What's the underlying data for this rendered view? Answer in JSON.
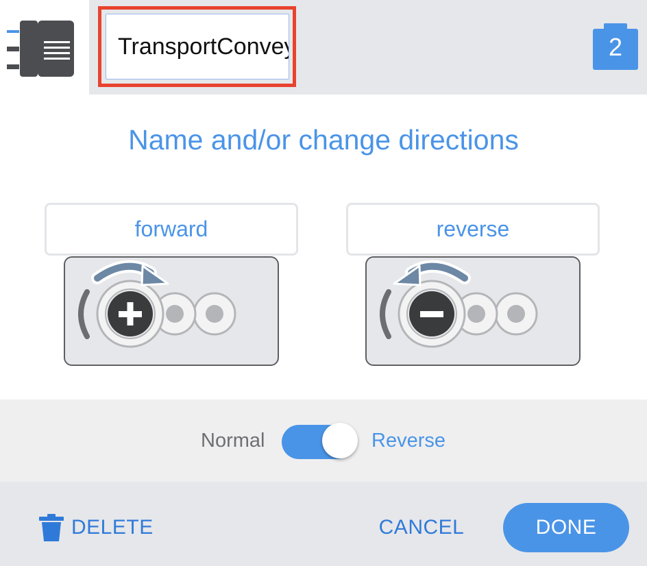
{
  "header": {
    "brick_icon": "device-brick-icon",
    "name_value": "TransportConveyor",
    "port_badge": "2",
    "port_icon": "port-badge-icon"
  },
  "main": {
    "title": "Name and/or change directions",
    "forward": {
      "label": "forward",
      "sign": "+",
      "icon": "clockwise-motor-icon"
    },
    "reverse": {
      "label": "reverse",
      "sign": "−",
      "icon": "counterclockwise-motor-icon"
    }
  },
  "toggle": {
    "left_label": "Normal",
    "right_label": "Reverse",
    "state": "Reverse"
  },
  "footer": {
    "delete_label": "DELETE",
    "delete_icon": "trash-icon",
    "cancel_label": "CANCEL",
    "done_label": "DONE"
  },
  "colors": {
    "accent": "#4a94e7",
    "highlight_outline": "#e8432f",
    "header_bg": "#e6e7ea"
  }
}
